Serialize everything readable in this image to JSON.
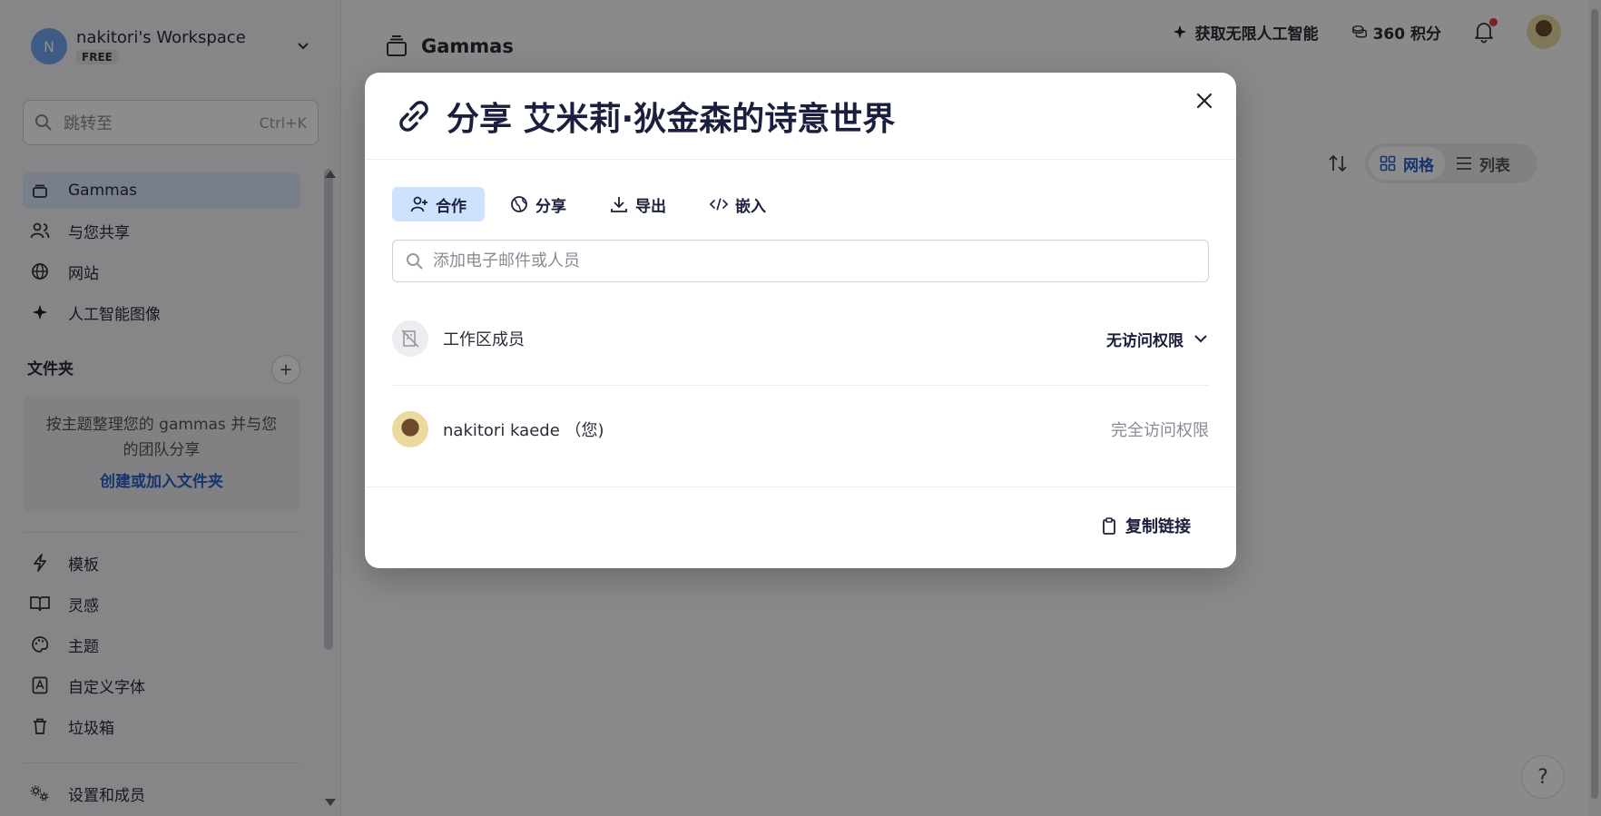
{
  "workspace": {
    "initial": "N",
    "name": "nakitori's Workspace",
    "plan": "FREE"
  },
  "search": {
    "placeholder": "跳转至",
    "shortcut": "Ctrl+K"
  },
  "sidebar": {
    "items": [
      {
        "label": "Gammas",
        "icon": "stack-icon"
      },
      {
        "label": "与您共享",
        "icon": "users-icon"
      },
      {
        "label": "网站",
        "icon": "globe-icon"
      },
      {
        "label": "人工智能图像",
        "icon": "sparkle-icon"
      }
    ],
    "folders_title": "文件夹",
    "folders_hint": "按主题整理您的 gammas 并与您的团队分享",
    "folders_link": "创建或加入文件夹",
    "bottom_items": [
      {
        "label": "模板",
        "icon": "bolt-icon"
      },
      {
        "label": "灵感",
        "icon": "book-icon"
      },
      {
        "label": "主题",
        "icon": "palette-icon"
      },
      {
        "label": "自定义字体",
        "icon": "font-icon"
      },
      {
        "label": "垃圾箱",
        "icon": "trash-icon"
      }
    ],
    "settings_label": "设置和成员"
  },
  "main": {
    "title": "Gammas",
    "ai_promo": "获取无限人工智能",
    "credits": "360 积分",
    "view_grid": "网格",
    "view_list": "列表",
    "help": "?"
  },
  "modal": {
    "title": "分享 艾米莉·狄金森的诗意世界",
    "tabs": [
      {
        "label": "合作",
        "icon": "user-plus-icon",
        "active": true
      },
      {
        "label": "分享",
        "icon": "globe-icon",
        "active": false
      },
      {
        "label": "导出",
        "icon": "download-icon",
        "active": false
      },
      {
        "label": "嵌入",
        "icon": "code-icon",
        "active": false
      }
    ],
    "input_placeholder": "添加电子邮件或人员",
    "workspace_row": {
      "name": "工作区成员",
      "access": "无访问权限"
    },
    "user_row": {
      "name": "nakitori kaede （您)",
      "permission": "完全访问权限"
    },
    "copy_link": "复制链接"
  },
  "colors": {
    "accent": "#2d5fc8",
    "active_tab": "#cfe2fb",
    "notification": "#e23b3b"
  }
}
